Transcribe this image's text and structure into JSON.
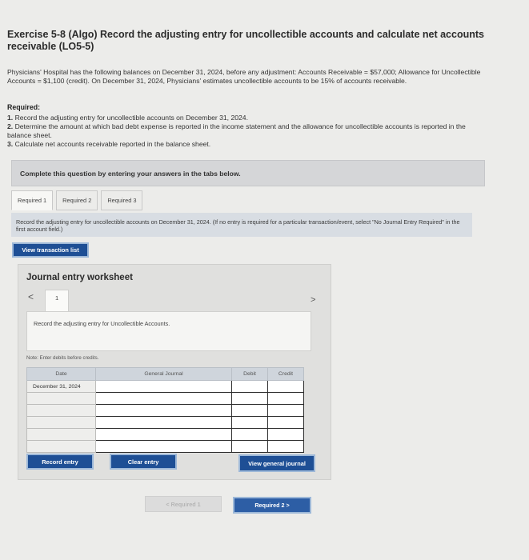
{
  "exercise": {
    "title": "Exercise 5-8 (Algo) Record the adjusting entry for uncollectible accounts and calculate net accounts receivable (LO5-5)",
    "paragraph": "Physicians' Hospital has the following balances on December 31, 2024, before any adjustment: Accounts Receivable = $57,000; Allowance for Uncollectible Accounts = $1,100 (credit). On December 31, 2024, Physicians' estimates uncollectible accounts to be 15% of accounts receivable.",
    "required_heading": "Required:",
    "requirements": [
      {
        "num": "1.",
        "text": "Record the adjusting entry for uncollectible accounts on December 31, 2024."
      },
      {
        "num": "2.",
        "text": "Determine the amount at which bad debt expense is reported in the income statement and the allowance for uncollectible accounts is reported in the balance sheet."
      },
      {
        "num": "3.",
        "text": "Calculate net accounts receivable reported in the balance sheet."
      }
    ]
  },
  "banner": "Complete this question by entering your answers in the tabs below.",
  "tabs": [
    "Required 1",
    "Required 2",
    "Required 3"
  ],
  "instruction": "Record the adjusting entry for uncollectible accounts on December 31, 2024. (If no entry is required for a particular transaction/event, select \"No Journal Entry Required\" in the first account field.)",
  "buttons": {
    "view_transaction_list": "View transaction list",
    "record_entry": "Record entry",
    "clear_entry": "Clear entry",
    "view_general_journal": "View general journal",
    "prev_required": "< Required 1",
    "next_required": "Required 2  >"
  },
  "worksheet": {
    "heading": "Journal entry worksheet",
    "nav_prev": "<",
    "nav_next": ">",
    "page": "1",
    "description": "Record the adjusting entry for Uncollectible Accounts.",
    "note": "Note: Enter debits before credits.",
    "columns": {
      "date": "Date",
      "account": "General Journal",
      "debit": "Debit",
      "credit": "Credit"
    },
    "rows": [
      {
        "date": "December 31, 2024"
      },
      {
        "date": ""
      },
      {
        "date": ""
      },
      {
        "date": ""
      },
      {
        "date": ""
      },
      {
        "date": ""
      }
    ]
  }
}
